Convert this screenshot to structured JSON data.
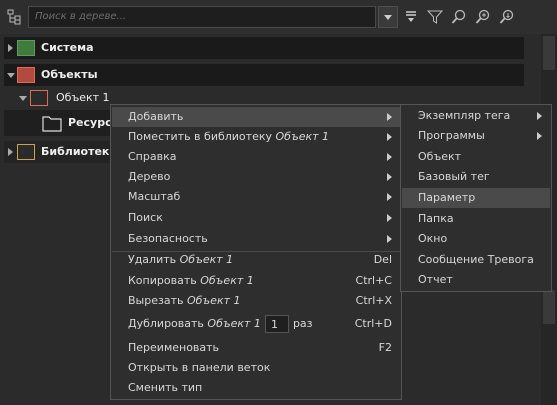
{
  "search": {
    "placeholder": "Поиск в дереве..."
  },
  "toolbar": {
    "icons": [
      "tree-structure-icon",
      "filter-down-icon",
      "filter-icon",
      "search-icon",
      "zoom-in-icon",
      "zoom-out-icon"
    ]
  },
  "tree": {
    "items": [
      {
        "label": "Система",
        "color": "#5a9e5a"
      },
      {
        "label": "Объекты",
        "color": "#e06a5a"
      },
      {
        "label": "Объект 1",
        "color": "#e06a5a"
      },
      {
        "label": "Ресурсы"
      },
      {
        "label": "Библиотеки"
      }
    ]
  },
  "context_menu": {
    "add": "Добавить",
    "place_prefix": "Поместить в библиотеку",
    "object_name": "Объект 1",
    "help": "Справка",
    "tree": "Дерево",
    "scale": "Масштаб",
    "search": "Поиск",
    "security": "Безопасность",
    "delete_prefix": "Удалить",
    "delete_shortcut": "Del",
    "copy_prefix": "Копировать",
    "copy_shortcut": "Ctrl+C",
    "cut_prefix": "Вырезать",
    "cut_shortcut": "Ctrl+X",
    "duplicate_prefix": "Дублировать",
    "duplicate_count": "1",
    "duplicate_suffix": "раз",
    "duplicate_shortcut": "Ctrl+D",
    "rename": "Переименовать",
    "rename_shortcut": "F2",
    "open_branch": "Открыть в панели веток",
    "change_type": "Сменить тип"
  },
  "submenu": {
    "items": [
      "Экземпляр тега",
      "Программы",
      "Объект",
      "Базовый тег",
      "Параметр",
      "Папка",
      "Окно",
      "Сообщение Тревога",
      "Отчет"
    ],
    "highlighted": "Параметр"
  },
  "colors": {
    "background": "#2b2b2b",
    "menu": "#2e2e2e",
    "highlight": "#4a4a4a",
    "object_icon": "#e06a5a",
    "system_icon": "#5a9e5a",
    "library_icon": "#c9a24a"
  }
}
